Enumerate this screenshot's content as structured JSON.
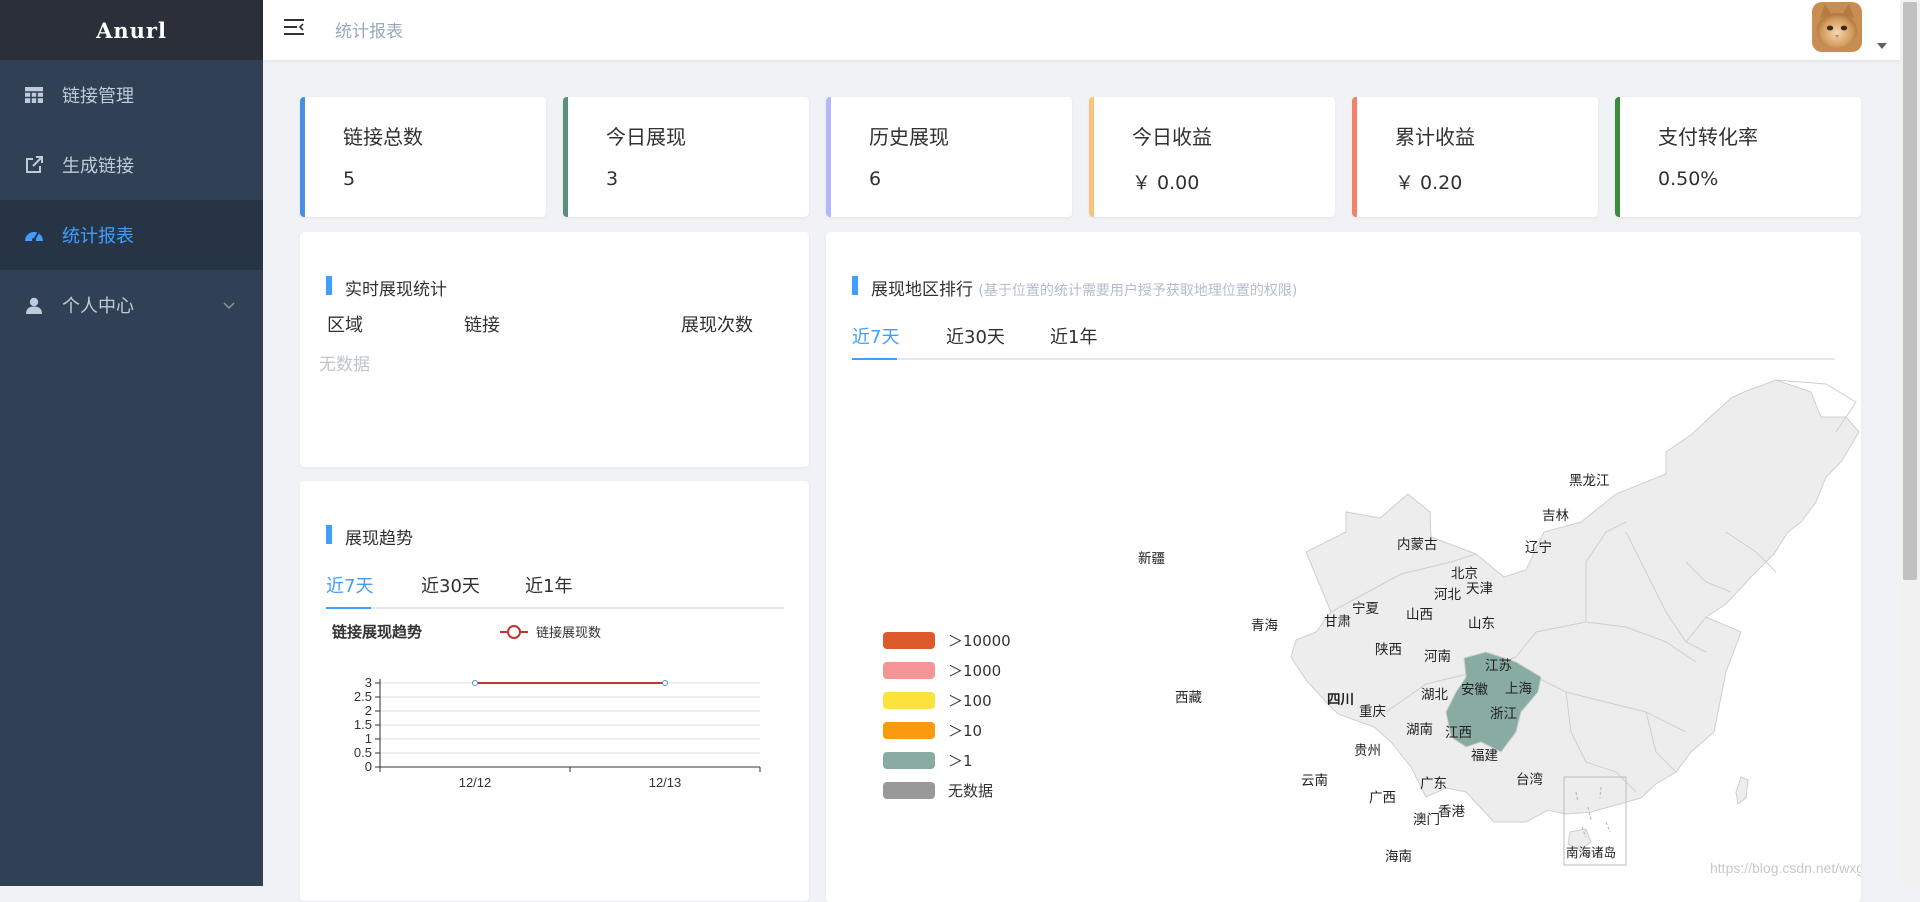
{
  "app": {
    "logo": "Anurl"
  },
  "sidebar": {
    "items": [
      {
        "label": "链接管理",
        "icon": "table-icon"
      },
      {
        "label": "生成链接",
        "icon": "external-link-icon"
      },
      {
        "label": "统计报表",
        "icon": "dashboard-icon",
        "active": true
      },
      {
        "label": "个人中心",
        "icon": "user-icon",
        "expandable": true
      }
    ]
  },
  "header": {
    "breadcrumb": "统计报表"
  },
  "stats": [
    {
      "label": "链接总数",
      "value": "5",
      "color": "#4a90e2"
    },
    {
      "label": "今日展现",
      "value": "3",
      "color": "#5b8f79"
    },
    {
      "label": "历史展现",
      "value": "6",
      "color": "#b3b7ff"
    },
    {
      "label": "今日收益",
      "value": "￥ 0.00",
      "color": "#f9c37b"
    },
    {
      "label": "累计收益",
      "value": "￥ 0.20",
      "color": "#f2826c"
    },
    {
      "label": "支付转化率",
      "value": "0.50%",
      "color": "#3a8b3a"
    }
  ],
  "realtime": {
    "title": "实时展现统计",
    "columns": [
      "区域",
      "链接",
      "展现次数"
    ],
    "empty_text": "无数据"
  },
  "trend": {
    "title": "展现趋势",
    "tabs": [
      "近7天",
      "近30天",
      "近1年"
    ],
    "chart_title": "链接展现趋势",
    "legend": "链接展现数"
  },
  "chart_data": {
    "type": "line",
    "title": "链接展现趋势",
    "x": [
      "12/12",
      "12/13"
    ],
    "series": [
      {
        "name": "链接展现数",
        "values": [
          3,
          3
        ]
      }
    ],
    "yticks": [
      "0",
      "0.5",
      "1",
      "1.5",
      "2",
      "2.5",
      "3"
    ],
    "ylim": [
      0,
      3
    ],
    "grid": true,
    "legend_position": "top",
    "color": "#c23531"
  },
  "region": {
    "title": "展现地区排行",
    "subtitle": "(基于位置的统计需要用户授予获取地理位置的权限)",
    "tabs": [
      "近7天",
      "近30天",
      "近1年"
    ],
    "legend": [
      {
        "label": "＞10000",
        "color": "#dd5b2b"
      },
      {
        "label": "＞1000",
        "color": "#f59596"
      },
      {
        "label": "＞100",
        "color": "#fbe23d"
      },
      {
        "label": "＞10",
        "color": "#fb9a0e"
      },
      {
        "label": "＞1",
        "color": "#88aba2"
      },
      {
        "label": "无数据",
        "color": "#999999"
      }
    ],
    "map_labels": [
      "黑龙江",
      "吉林",
      "辽宁",
      "内蒙古",
      "北京",
      "天津",
      "河北",
      "新疆",
      "宁夏",
      "山西",
      "山东",
      "青海",
      "甘肃",
      "陕西",
      "河南",
      "江苏",
      "四川",
      "上海",
      "湖北",
      "安徽",
      "重庆",
      "浙江",
      "西藏",
      "湖南",
      "江西",
      "贵州",
      "福建",
      "云南",
      "广东",
      "台湾",
      "广西",
      "香港",
      "澳门",
      "海南",
      "南海诸岛"
    ],
    "highlighted": "四川"
  },
  "watermark": "https://blog.csdn.net/wxgxgp"
}
